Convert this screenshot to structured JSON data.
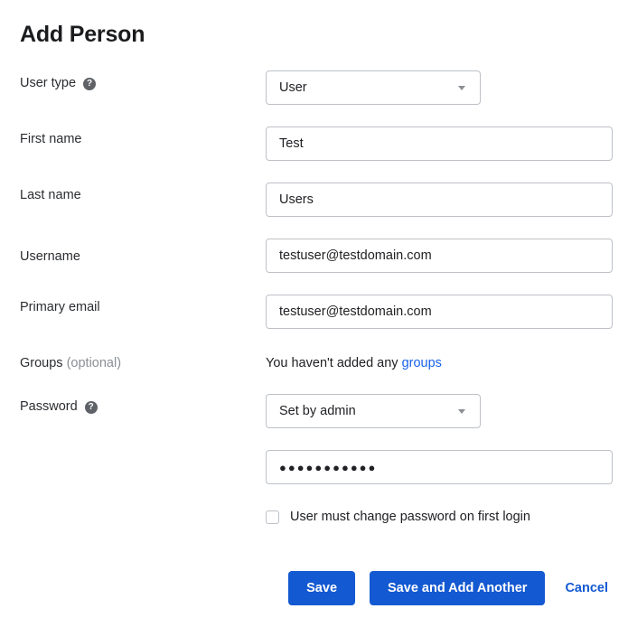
{
  "title": "Add Person",
  "fields": {
    "user_type": {
      "label": "User type",
      "help_glyph": "?",
      "value": "User"
    },
    "first_name": {
      "label": "First name",
      "value": "Test"
    },
    "last_name": {
      "label": "Last name",
      "value": "Users"
    },
    "username": {
      "label": "Username",
      "value": "testuser@testdomain.com"
    },
    "primary_email": {
      "label": "Primary email",
      "value": "testuser@testdomain.com"
    },
    "groups": {
      "label": "Groups",
      "optional_suffix": "(optional)",
      "empty_text": "You haven't added any",
      "link_text": "groups"
    },
    "password": {
      "label": "Password",
      "help_glyph": "?",
      "mode_value": "Set by admin",
      "masked_value": "●●●●●●●●●●●",
      "force_change_label": "User must change password on first login"
    }
  },
  "actions": {
    "save_label": "Save",
    "save_and_add_label": "Save and Add Another",
    "cancel_label": "Cancel"
  },
  "colors": {
    "accent": "#1359d1",
    "link": "#1a62e8",
    "border": "#bdc1c6",
    "text": "#202124",
    "muted": "#8b8f94"
  }
}
